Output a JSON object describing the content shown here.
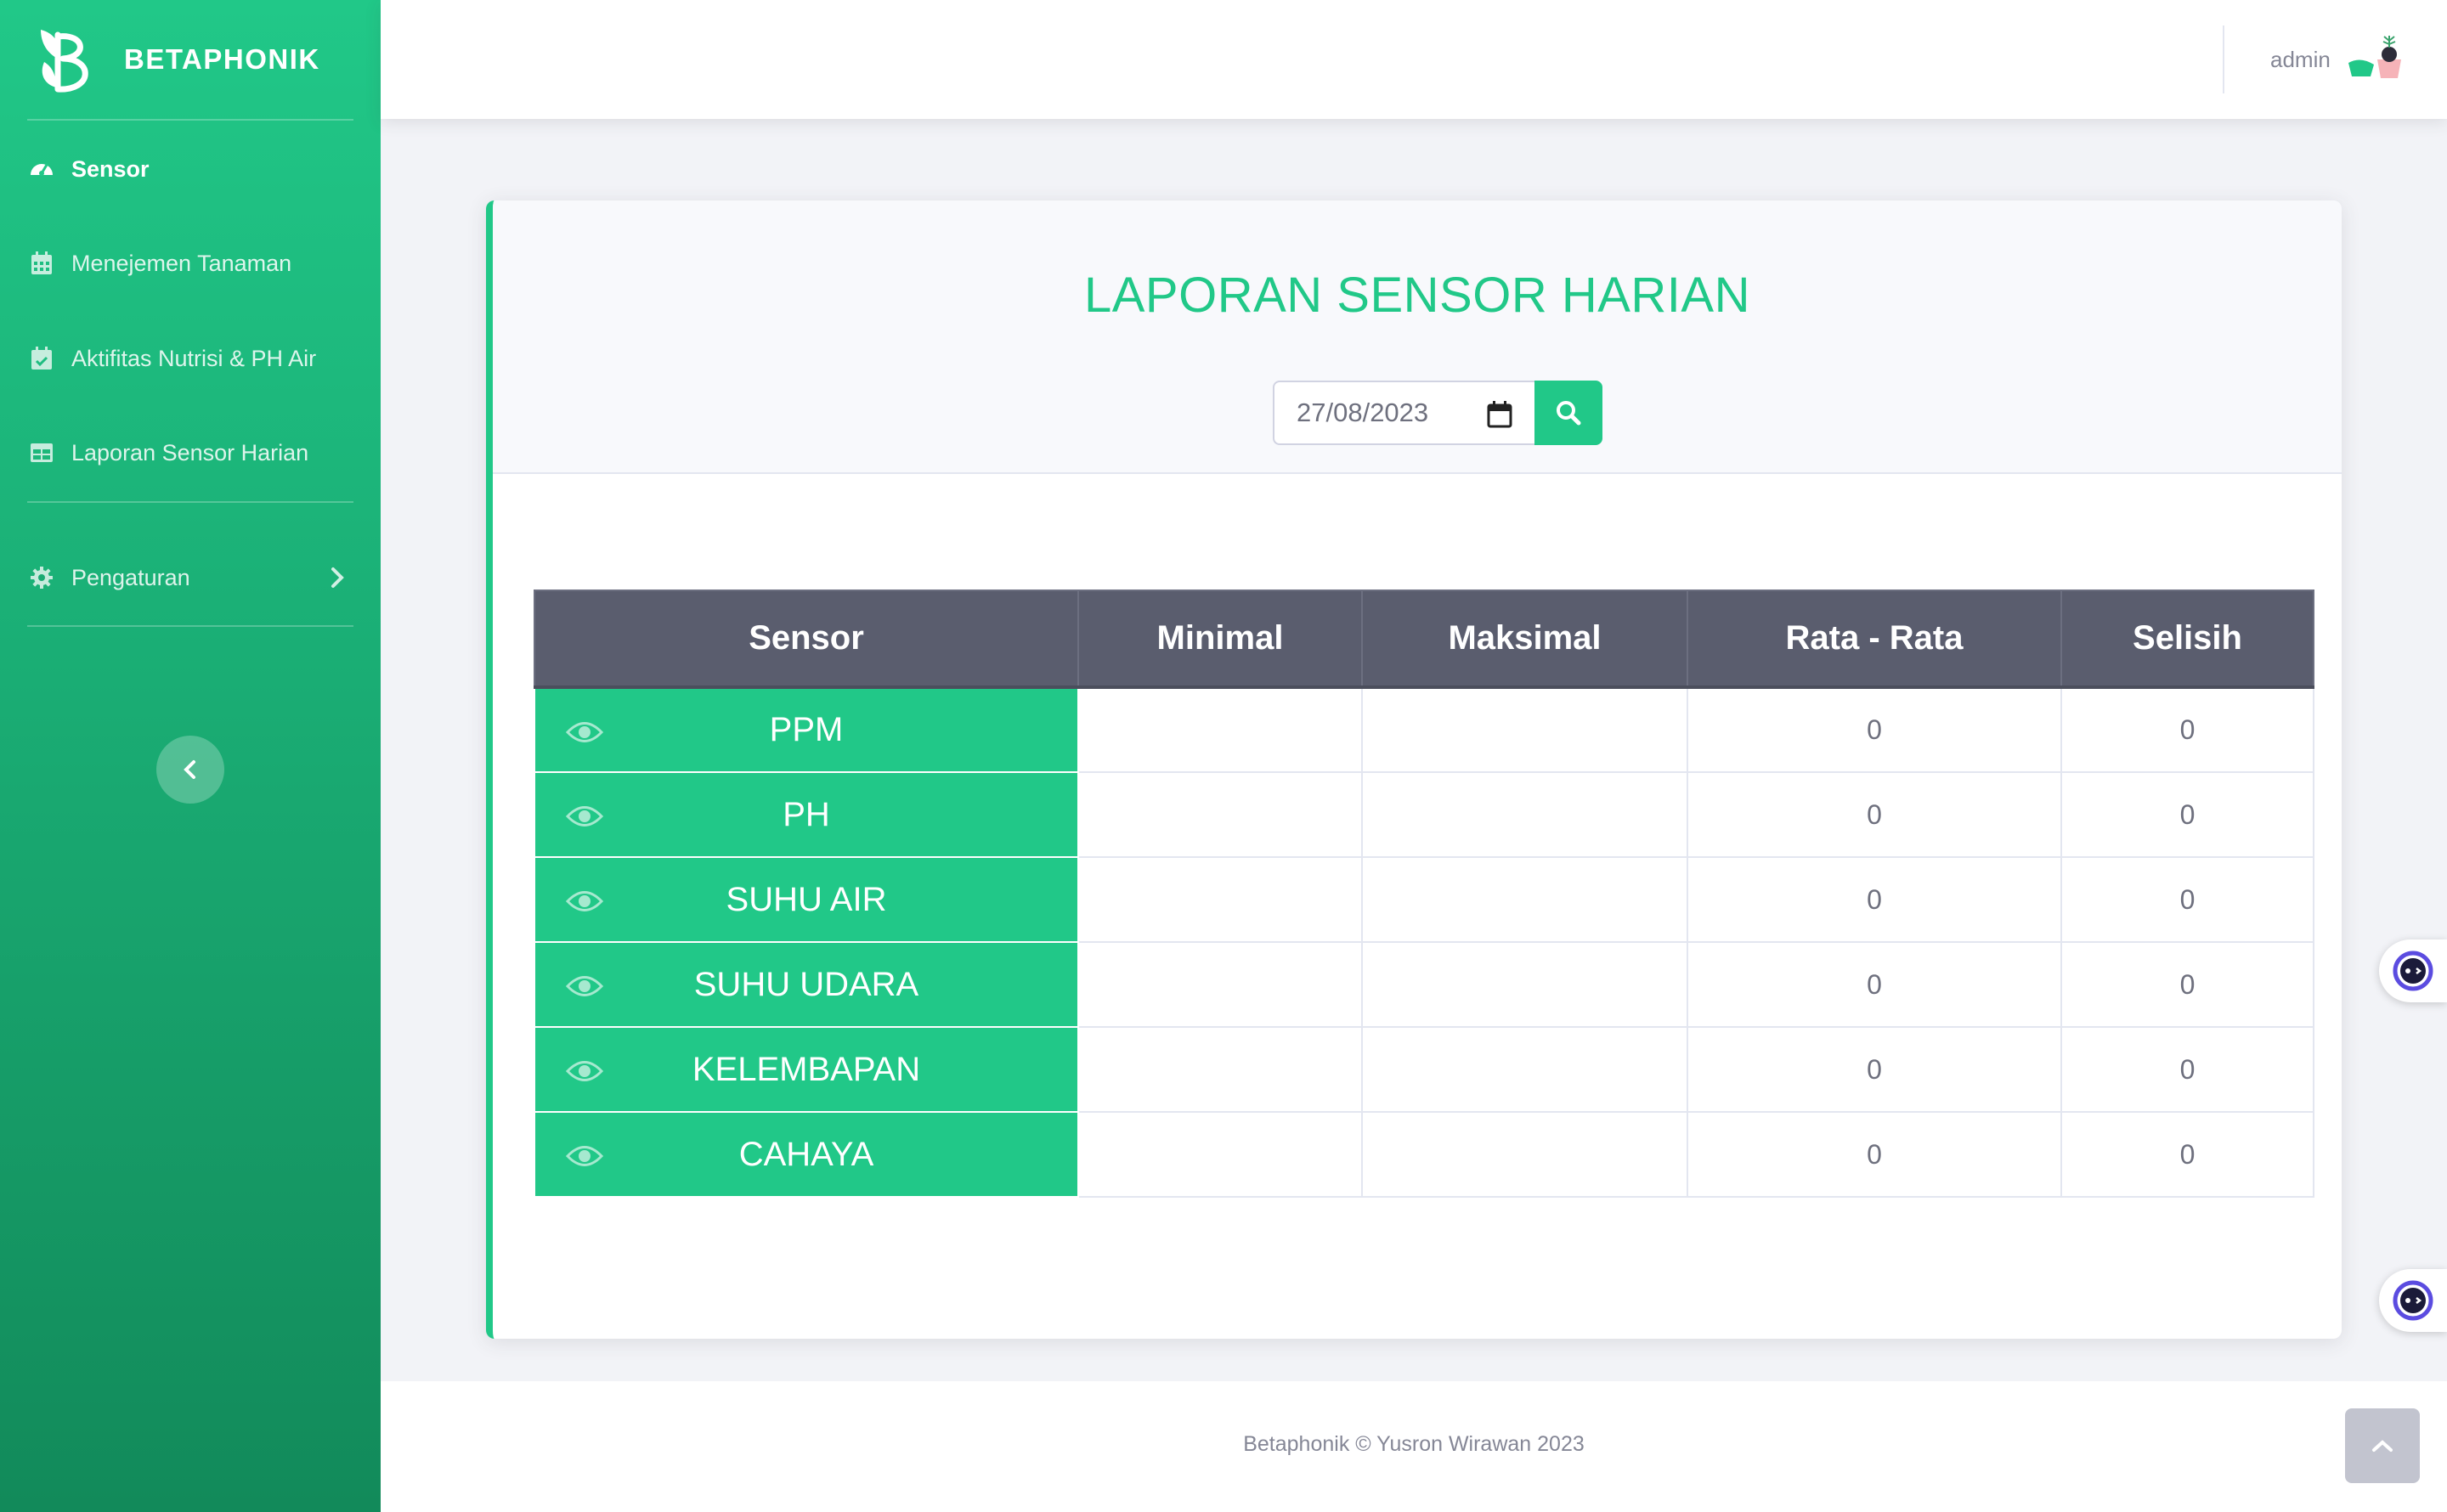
{
  "brand": {
    "name": "BETAPHONIK",
    "logo_icon": "leaf-b-logo"
  },
  "sidebar": {
    "items": [
      {
        "label": "Sensor",
        "icon": "tachometer-icon",
        "active": true
      },
      {
        "label": "Menejemen Tanaman",
        "icon": "calendar-icon",
        "active": false
      },
      {
        "label": "Aktifitas Nutrisi & PH Air",
        "icon": "calendar-check-icon",
        "active": false
      },
      {
        "label": "Laporan Sensor Harian",
        "icon": "table-icon",
        "active": false
      },
      {
        "label": "Pengaturan",
        "icon": "gear-icon",
        "active": false,
        "has_submenu": true
      }
    ]
  },
  "topbar": {
    "user_name": "admin"
  },
  "report": {
    "title": "LAPORAN SENSOR HARIAN",
    "date_value": "27/08/2023"
  },
  "table": {
    "headers": [
      "Sensor",
      "Minimal",
      "Maksimal",
      "Rata - Rata",
      "Selisih"
    ],
    "rows": [
      {
        "sensor": "PPM",
        "minimal": "",
        "maksimal": "",
        "rata": "0",
        "selisih": "0"
      },
      {
        "sensor": "PH",
        "minimal": "",
        "maksimal": "",
        "rata": "0",
        "selisih": "0"
      },
      {
        "sensor": "SUHU AIR",
        "minimal": "",
        "maksimal": "",
        "rata": "0",
        "selisih": "0"
      },
      {
        "sensor": "SUHU UDARA",
        "minimal": "",
        "maksimal": "",
        "rata": "0",
        "selisih": "0"
      },
      {
        "sensor": "KELEMBAPAN",
        "minimal": "",
        "maksimal": "",
        "rata": "0",
        "selisih": "0"
      },
      {
        "sensor": "CAHAYA",
        "minimal": "",
        "maksimal": "",
        "rata": "0",
        "selisih": "0"
      }
    ]
  },
  "footer": {
    "text": "Betaphonik © Yusron Wirawan 2023"
  },
  "colors": {
    "accent": "#21c888",
    "table_header": "#5a5d6e",
    "text_muted": "#858796"
  }
}
